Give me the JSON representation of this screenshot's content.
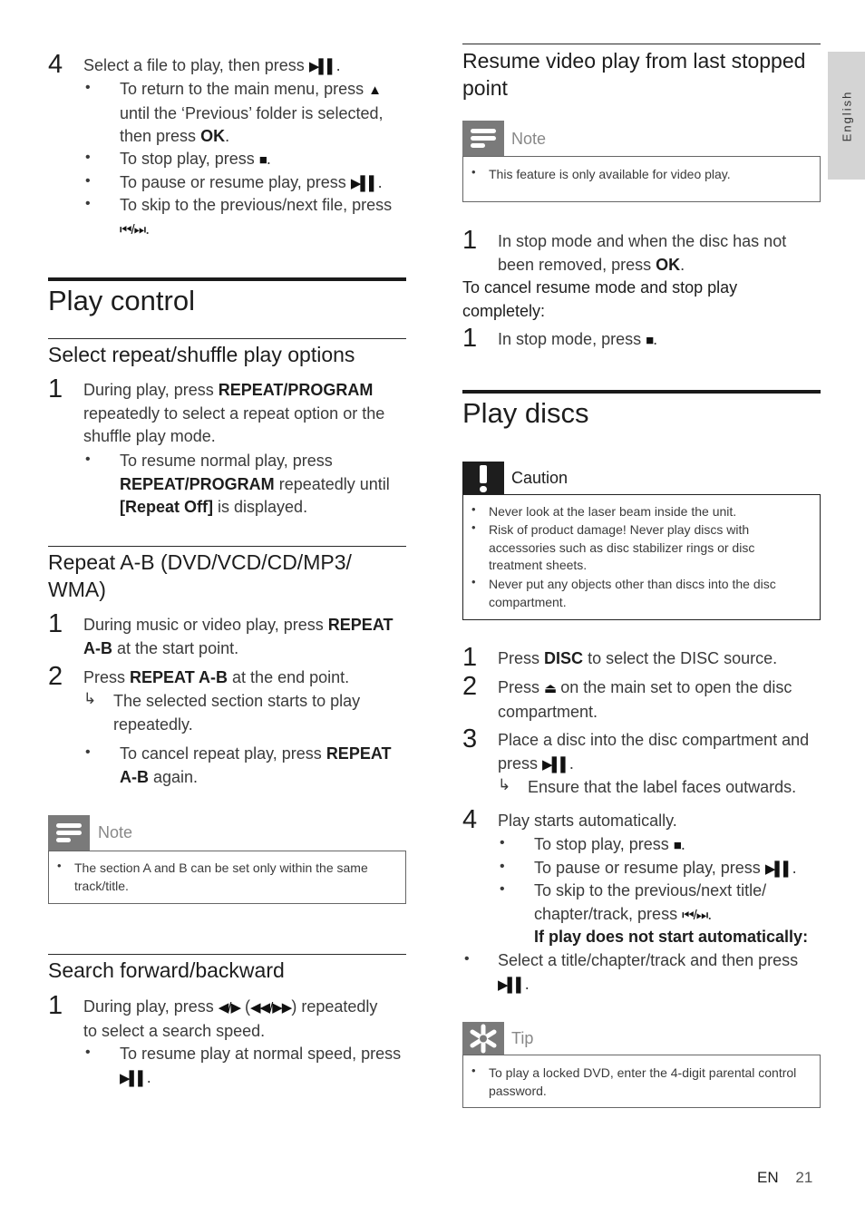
{
  "side_tab": {
    "label": "English"
  },
  "footer": {
    "lang": "EN",
    "page": "21"
  },
  "left": {
    "step4": {
      "number": "4",
      "text": "Select a file to play, then press",
      "bullets": [
        {
          "pre": "To return to the main menu, press",
          "line2": "until the ‘Previous’ folder is selected,",
          "line3_pre": "then press",
          "bold": "OK",
          "post": "."
        },
        {
          "pre": "To stop play, press",
          "post": "."
        },
        {
          "pre": "To pause or resume play, press",
          "post": "."
        },
        {
          "pre": "To skip to the previous/next file, press",
          "post": "."
        }
      ]
    },
    "play_control": {
      "title": "Play control",
      "repeat_shuffle": {
        "title": "Select repeat/shuffle play options",
        "step1": {
          "number": "1",
          "pre": "During play, press",
          "bold": "REPEAT/PROGRAM",
          "line2": "repeatedly to select a repeat option or the",
          "line3": "shuffle play mode."
        },
        "bullet": {
          "line1": "To resume normal play, press",
          "bold1": "REPEAT/PROGRAM",
          "post1": "repeatedly until",
          "bold2": "[Repeat Off]",
          "post2": "is displayed."
        }
      },
      "repeat_ab": {
        "title_line1": "Repeat A-B (DVD/VCD/CD/MP3/",
        "title_line2": "WMA)",
        "step1": {
          "number": "1",
          "pre": "During music or video play, press",
          "bold1": "REPEAT",
          "bold2": "A-B",
          "post": "at the start point."
        },
        "step2": {
          "number": "2",
          "pre": "Press",
          "bold": "REPEAT A-B",
          "post": "at the end point."
        },
        "result": {
          "line1": "The selected section starts to play",
          "line2": "repeatedly."
        },
        "bullet": {
          "pre": "To cancel repeat play, press",
          "bold1": "REPEAT",
          "bold2": "A-B",
          "post": "again."
        }
      },
      "note": {
        "label": "Note",
        "items": [
          {
            "line1": "The section A and B can be set only within the same",
            "line2": "track/title."
          }
        ]
      },
      "search": {
        "title": "Search forward/backward",
        "step1": {
          "number": "1",
          "pre": "During play, press",
          "mid": "(",
          "post": ") repeatedly",
          "line2": "to select a search speed."
        },
        "bullet": {
          "text": "To resume play at normal speed, press"
        }
      }
    }
  },
  "right": {
    "resume": {
      "title_line1": "Resume video play from last stopped",
      "title_line2": "point",
      "note": {
        "label": "Note",
        "items": [
          "This feature is only available for video play."
        ]
      },
      "step1": {
        "number": "1",
        "line1": "In stop mode and when the disc has not",
        "line2_pre": "been removed, press",
        "bold": "OK",
        "post": "."
      },
      "cancel_heading_line1": "To cancel resume mode and stop play",
      "cancel_heading_line2": "completely:",
      "step1b": {
        "number": "1",
        "pre": "In stop mode, press",
        "post": "."
      }
    },
    "play_discs": {
      "title": "Play discs",
      "caution": {
        "label": "Caution",
        "items": [
          {
            "lines": [
              "Never look at the laser beam inside the unit."
            ]
          },
          {
            "lines": [
              "Risk of product damage! Never play discs with",
              "accessories such as disc stabilizer rings or disc",
              "treatment sheets."
            ]
          },
          {
            "lines": [
              "Never put any objects other than discs into the disc",
              "compartment."
            ]
          }
        ]
      },
      "steps": [
        {
          "number": "1",
          "pre": "Press",
          "bold": "DISC",
          "post": "to select the DISC source."
        },
        {
          "number": "2",
          "pre": "Press",
          "post": "on the main set to open the disc",
          "line2": "compartment."
        },
        {
          "number": "3",
          "line1": "Place a disc into the disc compartment and",
          "line2_pre": "press",
          "result": "Ensure that the label faces outwards."
        },
        {
          "number": "4",
          "text": "Play starts automatically."
        }
      ],
      "step4_bullets": [
        {
          "pre": "To stop play, press",
          "post": "."
        },
        {
          "pre": "To pause or resume play, press",
          "post": "."
        },
        {
          "line1": "To skip to the previous/next title/",
          "line2_pre": "chapter/track, press",
          "post": "."
        }
      ],
      "if_not_auto": "If play does not start automatically:",
      "select_bullet": {
        "text": "Select a title/chapter/track and then press"
      },
      "tip": {
        "label": "Tip",
        "items": [
          {
            "line1": "To play a locked DVD, enter the 4-digit parental control",
            "line2": "password."
          }
        ]
      }
    }
  },
  "symbols": {
    "play_pause": "▶▌▌",
    "up": "▲",
    "stop": "■",
    "prev_next": "⏮/⏭",
    "left_right": "◀/▶",
    "rew_ff": "◀◀/▶▶",
    "eject": "⏏",
    "result_arrow": "↳",
    "bullet": "•"
  }
}
